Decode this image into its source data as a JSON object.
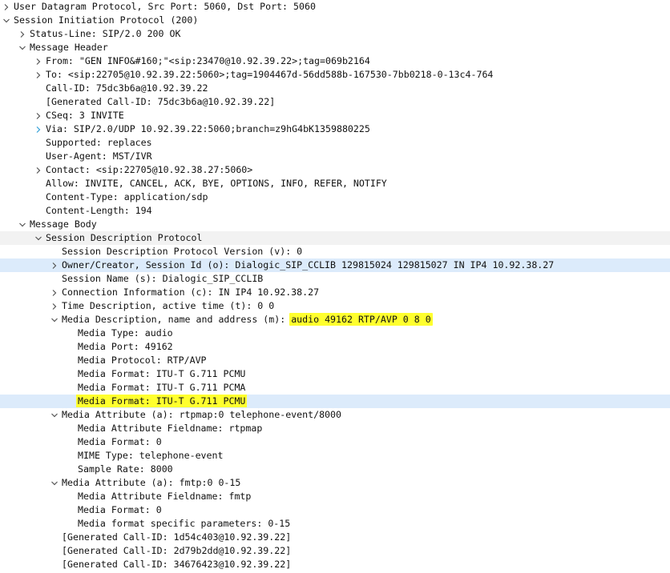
{
  "colors": {
    "selection": "#dcebfb",
    "highlight": "#ffff2e",
    "arrow_expanded": "#555555",
    "arrow_collapsed": "#555555",
    "arrow_hover": "#33a0d8"
  },
  "rows": [
    {
      "level": 0,
      "toggle": "collapsed",
      "text": "User Datagram Protocol, Src Port: 5060, Dst Port: 5060",
      "name": "tree-node-udp"
    },
    {
      "level": 0,
      "toggle": "expanded",
      "text": "Session Initiation Protocol (200)",
      "name": "tree-node-sip"
    },
    {
      "level": 1,
      "toggle": "collapsed",
      "text": "Status-Line: SIP/2.0 200 OK",
      "name": "tree-node-status-line"
    },
    {
      "level": 1,
      "toggle": "expanded",
      "text": "Message Header",
      "name": "tree-node-message-header"
    },
    {
      "level": 2,
      "toggle": "collapsed",
      "text": "From: \"GEN INFO&#160;\"<sip:23470@10.92.39.22>;tag=069b2164",
      "name": "tree-node-from"
    },
    {
      "level": 2,
      "toggle": "collapsed",
      "text": "To: <sip:22705@10.92.39.22:5060>;tag=1904467d-56dd588b-167530-7bb0218-0-13c4-764",
      "name": "tree-node-to"
    },
    {
      "level": 2,
      "toggle": "none",
      "text": "Call-ID: 75dc3b6a@10.92.39.22",
      "name": "tree-leaf-call-id"
    },
    {
      "level": 2,
      "toggle": "none",
      "text": "[Generated Call-ID: 75dc3b6a@10.92.39.22]",
      "name": "tree-leaf-generated-call-id"
    },
    {
      "level": 2,
      "toggle": "collapsed",
      "text": "CSeq: 3 INVITE",
      "name": "tree-node-cseq"
    },
    {
      "level": 2,
      "toggle": "collapsed-hover",
      "text": "Via: SIP/2.0/UDP 10.92.39.22:5060;branch=z9hG4bK1359880225",
      "name": "tree-node-via"
    },
    {
      "level": 2,
      "toggle": "none",
      "text": "Supported: replaces",
      "name": "tree-leaf-supported"
    },
    {
      "level": 2,
      "toggle": "none",
      "text": "User-Agent: MST/IVR",
      "name": "tree-leaf-user-agent"
    },
    {
      "level": 2,
      "toggle": "collapsed",
      "text": "Contact: <sip:22705@10.92.38.27:5060>",
      "name": "tree-node-contact"
    },
    {
      "level": 2,
      "toggle": "none",
      "text": "Allow: INVITE, CANCEL, ACK, BYE, OPTIONS, INFO, REFER, NOTIFY",
      "name": "tree-leaf-allow"
    },
    {
      "level": 2,
      "toggle": "none",
      "text": "Content-Type: application/sdp",
      "name": "tree-leaf-content-type"
    },
    {
      "level": 2,
      "toggle": "none",
      "text": "Content-Length: 194",
      "name": "tree-leaf-content-length"
    },
    {
      "level": 1,
      "toggle": "expanded",
      "text": "Message Body",
      "name": "tree-node-message-body"
    },
    {
      "level": 2,
      "toggle": "expanded",
      "text": "Session Description Protocol",
      "name": "tree-node-sdp",
      "band": true
    },
    {
      "level": 3,
      "toggle": "none",
      "text": "Session Description Protocol Version (v): 0",
      "name": "tree-leaf-sdp-version"
    },
    {
      "level": 3,
      "toggle": "collapsed",
      "text": "Owner/Creator, Session Id (o): Dialogic_SIP_CCLIB 129815024 129815027 IN IP4 10.92.38.27",
      "name": "tree-node-owner",
      "selected": true
    },
    {
      "level": 3,
      "toggle": "none",
      "text": "Session Name (s): Dialogic_SIP_CCLIB",
      "name": "tree-leaf-session-name"
    },
    {
      "level": 3,
      "toggle": "collapsed",
      "text": "Connection Information (c): IN IP4 10.92.38.27",
      "name": "tree-node-connection-info"
    },
    {
      "level": 3,
      "toggle": "collapsed",
      "text": "Time Description, active time (t): 0 0",
      "name": "tree-node-time-description"
    },
    {
      "level": 3,
      "toggle": "expanded",
      "text": "Media Description, name and address (m): ",
      "highlight": "audio 49162 RTP/AVP 0 8 0",
      "name": "tree-node-media-description"
    },
    {
      "level": 4,
      "toggle": "none",
      "text": "Media Type: audio",
      "name": "tree-leaf-media-type"
    },
    {
      "level": 4,
      "toggle": "none",
      "text": "Media Port: 49162",
      "name": "tree-leaf-media-port"
    },
    {
      "level": 4,
      "toggle": "none",
      "text": "Media Protocol: RTP/AVP",
      "name": "tree-leaf-media-protocol"
    },
    {
      "level": 4,
      "toggle": "none",
      "text": "Media Format: ITU-T G.711 PCMU",
      "name": "tree-leaf-media-format-1"
    },
    {
      "level": 4,
      "toggle": "none",
      "text": "Media Format: ITU-T G.711 PCMA",
      "name": "tree-leaf-media-format-2"
    },
    {
      "level": 4,
      "toggle": "none",
      "text": "",
      "highlight": "Media Format: ITU-T G.711 PCMU",
      "name": "tree-leaf-media-format-3",
      "selected": true
    },
    {
      "level": 3,
      "toggle": "expanded",
      "text": "Media Attribute (a): rtpmap:0 telephone-event/8000",
      "name": "tree-node-media-attribute-rtpmap"
    },
    {
      "level": 4,
      "toggle": "none",
      "text": "Media Attribute Fieldname: rtpmap",
      "name": "tree-leaf-attr-fieldname-rtpmap"
    },
    {
      "level": 4,
      "toggle": "none",
      "text": "Media Format: 0",
      "name": "tree-leaf-rtpmap-media-format"
    },
    {
      "level": 4,
      "toggle": "none",
      "text": "MIME Type: telephone-event",
      "name": "tree-leaf-mime-type"
    },
    {
      "level": 4,
      "toggle": "none",
      "text": "Sample Rate: 8000",
      "name": "tree-leaf-sample-rate"
    },
    {
      "level": 3,
      "toggle": "expanded",
      "text": "Media Attribute (a): fmtp:0 0-15",
      "name": "tree-node-media-attribute-fmtp"
    },
    {
      "level": 4,
      "toggle": "none",
      "text": "Media Attribute Fieldname: fmtp",
      "name": "tree-leaf-attr-fieldname-fmtp"
    },
    {
      "level": 4,
      "toggle": "none",
      "text": "Media Format: 0",
      "name": "tree-leaf-fmtp-media-format"
    },
    {
      "level": 4,
      "toggle": "none",
      "text": "Media format specific parameters: 0-15",
      "name": "tree-leaf-format-params"
    },
    {
      "level": 3,
      "toggle": "none",
      "text": "[Generated Call-ID: 1d54c403@10.92.39.22]",
      "name": "tree-leaf-generated-call-id-2"
    },
    {
      "level": 3,
      "toggle": "none",
      "text": "[Generated Call-ID: 2d79b2dd@10.92.39.22]",
      "name": "tree-leaf-generated-call-id-3"
    },
    {
      "level": 3,
      "toggle": "none",
      "text": "[Generated Call-ID: 34676423@10.92.39.22]",
      "name": "tree-leaf-generated-call-id-4"
    }
  ]
}
